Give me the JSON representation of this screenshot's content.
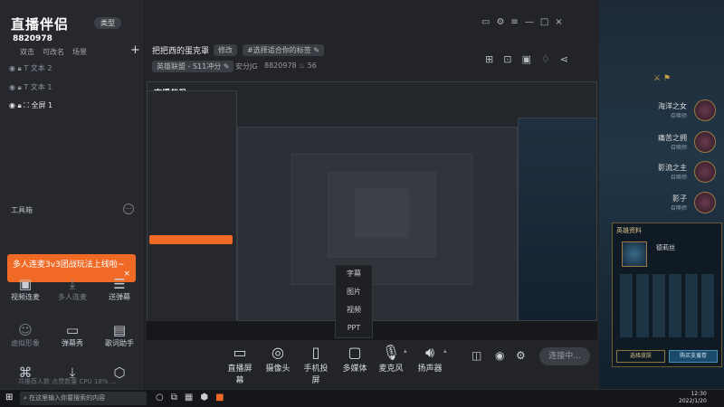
{
  "sidebar": {
    "logo": "直播伴侣",
    "type_button": "类型",
    "room_id": "8820978",
    "tabs": [
      "双击",
      "可改名",
      "场景"
    ],
    "add_label": "+",
    "layers": [
      {
        "label": "文本 2"
      },
      {
        "label": "文本 1"
      },
      {
        "label": "全屏 1"
      }
    ],
    "toolbox_title": "工具箱",
    "tools": [
      {
        "label": "视频连麦",
        "icon": "video-link-icon"
      },
      {
        "label": "多人连麦",
        "icon": "download-icon"
      },
      {
        "label": "送弹幕",
        "icon": "danmaku-icon"
      },
      {
        "label": "虚拟形象",
        "icon": "avatar-icon"
      },
      {
        "label": "弹幕秀",
        "icon": "tv-icon"
      },
      {
        "label": "歌词助手",
        "icon": "lyrics-icon"
      }
    ],
    "promo_tip": "多人连麦3v3团战玩法上线啦~"
  },
  "header": {
    "title": "把把西的蛋克罩",
    "edit_button": "修改",
    "tag": "#选择适合你的标签",
    "category": "英雄联盟 - S11冲分",
    "security": "安分JG",
    "room_id": "8820978",
    "fans": "56"
  },
  "bottom_bar": {
    "buttons": [
      {
        "label": "直播屏幕"
      },
      {
        "label": "摄像头"
      },
      {
        "label": "手机投屏"
      },
      {
        "label": "多媒体"
      },
      {
        "label": "麦克风"
      },
      {
        "label": "扬声器"
      }
    ],
    "start_button": "连接中...",
    "multimedia_menu": [
      "字幕",
      "图片",
      "视频",
      "PPT"
    ]
  },
  "game": {
    "heroes": [
      {
        "name": "海洋之女",
        "sub": "召唤师"
      },
      {
        "name": "痛苦之拥",
        "sub": "召唤师"
      },
      {
        "name": "影流之主",
        "sub": "召唤师"
      },
      {
        "name": "影子",
        "sub": "召唤师"
      }
    ],
    "panel_title": "英雄资料",
    "panel_name": "德莉丝",
    "buttons": [
      "选择皮肤",
      "购买支援卷"
    ]
  },
  "taskbar": {
    "search_placeholder": "在这里输入你要搜索的内容",
    "time": "12:30",
    "date": "2022/1/20",
    "status": "共推荐人数    点赞数量    CPU 18%    ..."
  },
  "colors": {
    "accent": "#f06a25",
    "bg": "#25272c"
  }
}
